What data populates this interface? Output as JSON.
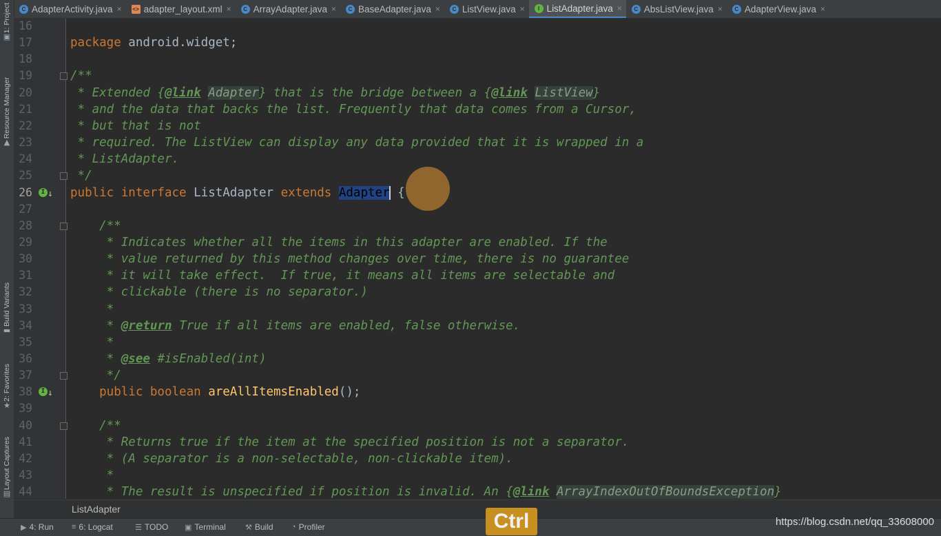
{
  "tabs": [
    {
      "label": "AdapterActivity.java",
      "icon": "C",
      "kind": "class",
      "active": false
    },
    {
      "label": "adapter_layout.xml",
      "icon": "<>",
      "kind": "xml",
      "active": false
    },
    {
      "label": "ArrayAdapter.java",
      "icon": "C",
      "kind": "class",
      "active": false
    },
    {
      "label": "BaseAdapter.java",
      "icon": "C",
      "kind": "class",
      "active": false
    },
    {
      "label": "ListView.java",
      "icon": "C",
      "kind": "class",
      "active": false
    },
    {
      "label": "ListAdapter.java",
      "icon": "I",
      "kind": "interface",
      "active": true
    },
    {
      "label": "AbsListView.java",
      "icon": "C",
      "kind": "class",
      "active": false
    },
    {
      "label": "AdapterView.java",
      "icon": "C",
      "kind": "class",
      "active": false
    }
  ],
  "tab_close_glyph": "×",
  "left_tools": [
    {
      "label": "1: Project",
      "icon": "project-icon"
    },
    {
      "label": "Resource Manager",
      "icon": "resource-manager-icon"
    },
    {
      "label": "Build Variants",
      "icon": "build-variants-icon"
    },
    {
      "label": "2: Favorites",
      "icon": "favorites-icon"
    },
    {
      "label": "Layout Captures",
      "icon": "layout-captures-icon"
    }
  ],
  "editor": {
    "current_line": 26,
    "lines": [
      {
        "n": 16,
        "tokens": []
      },
      {
        "n": 17,
        "tokens": [
          [
            "kw",
            "package "
          ],
          [
            "pl",
            "android.widget;"
          ]
        ]
      },
      {
        "n": 18,
        "tokens": []
      },
      {
        "n": 19,
        "fold": true,
        "tokens": [
          [
            "cm",
            "/**"
          ]
        ]
      },
      {
        "n": 20,
        "tokens": [
          [
            "cm",
            " * Extended {"
          ],
          [
            "tag",
            "@link"
          ],
          [
            "cm",
            " "
          ],
          [
            "ref",
            "Adapter"
          ],
          [
            "cm",
            "} that is the bridge between a {"
          ],
          [
            "tag",
            "@link"
          ],
          [
            "cm",
            " "
          ],
          [
            "ref",
            "ListView"
          ],
          [
            "cm",
            "}"
          ]
        ]
      },
      {
        "n": 21,
        "tokens": [
          [
            "cm",
            " * and the data that backs the list. Frequently that data comes from a Cursor,"
          ]
        ]
      },
      {
        "n": 22,
        "tokens": [
          [
            "cm",
            " * but that is not"
          ]
        ]
      },
      {
        "n": 23,
        "tokens": [
          [
            "cm",
            " * required. The ListView can display any data provided that it is wrapped in a"
          ]
        ]
      },
      {
        "n": 24,
        "tokens": [
          [
            "cm",
            " * ListAdapter."
          ]
        ]
      },
      {
        "n": 25,
        "fold": true,
        "tokens": [
          [
            "cm",
            " */"
          ]
        ]
      },
      {
        "n": 26,
        "gutter": "implemented",
        "tokens": [
          [
            "kw",
            "public interface "
          ],
          [
            "pl",
            "ListAdapter "
          ],
          [
            "kw",
            "extends "
          ],
          [
            "sel",
            "Adapter"
          ],
          [
            "caret",
            ""
          ],
          [
            "pl",
            " {"
          ]
        ]
      },
      {
        "n": 27,
        "tokens": []
      },
      {
        "n": 28,
        "fold": true,
        "tokens": [
          [
            "cm",
            "    /**"
          ]
        ]
      },
      {
        "n": 29,
        "tokens": [
          [
            "cm",
            "     * Indicates whether all the items in this adapter are enabled. If the"
          ]
        ]
      },
      {
        "n": 30,
        "tokens": [
          [
            "cm",
            "     * value returned by this method changes over time, there is no guarantee"
          ]
        ]
      },
      {
        "n": 31,
        "tokens": [
          [
            "cm",
            "     * it will take effect.  If true, it means all items are selectable and"
          ]
        ]
      },
      {
        "n": 32,
        "tokens": [
          [
            "cm",
            "     * clickable (there is no separator.)"
          ]
        ]
      },
      {
        "n": 33,
        "tokens": [
          [
            "cm",
            "     *"
          ]
        ]
      },
      {
        "n": 34,
        "tokens": [
          [
            "cm",
            "     * "
          ],
          [
            "tag",
            "@return"
          ],
          [
            "cm",
            " True if all items are enabled, false otherwise."
          ]
        ]
      },
      {
        "n": 35,
        "tokens": [
          [
            "cm",
            "     *"
          ]
        ]
      },
      {
        "n": 36,
        "tokens": [
          [
            "cm",
            "     * "
          ],
          [
            "tag",
            "@see"
          ],
          [
            "cm",
            " #isEnabled(int)"
          ]
        ]
      },
      {
        "n": 37,
        "fold": true,
        "tokens": [
          [
            "cm",
            "     */"
          ]
        ]
      },
      {
        "n": 38,
        "gutter": "implemented",
        "tokens": [
          [
            "kw",
            "    public boolean "
          ],
          [
            "fn",
            "areAllItemsEnabled"
          ],
          [
            "pl",
            "();"
          ]
        ]
      },
      {
        "n": 39,
        "tokens": []
      },
      {
        "n": 40,
        "fold": true,
        "tokens": [
          [
            "cm",
            "    /**"
          ]
        ]
      },
      {
        "n": 41,
        "tokens": [
          [
            "cm",
            "     * Returns true if the item at the specified position is not a separator."
          ]
        ]
      },
      {
        "n": 42,
        "tokens": [
          [
            "cm",
            "     * (A separator is a non-selectable, non-clickable item)."
          ]
        ]
      },
      {
        "n": 43,
        "tokens": [
          [
            "cm",
            "     *"
          ]
        ]
      },
      {
        "n": 44,
        "tokens": [
          [
            "cm",
            "     * The result is unspecified if position is invalid. An {"
          ],
          [
            "tag",
            "@link"
          ],
          [
            "cm",
            " "
          ],
          [
            "ref",
            "ArrayIndexOutOfBoundsException"
          ],
          [
            "cm",
            "}"
          ]
        ]
      }
    ]
  },
  "breadcrumb": "ListAdapter",
  "bottom_tools": [
    {
      "label": "4: Run",
      "icon": "run-icon",
      "glyph": "▶"
    },
    {
      "label": "6: Logcat",
      "icon": "logcat-icon",
      "glyph": "≡"
    },
    {
      "label": "TODO",
      "icon": "todo-icon",
      "glyph": "☰"
    },
    {
      "label": "Terminal",
      "icon": "terminal-icon",
      "glyph": "▣"
    },
    {
      "label": "Build",
      "icon": "build-icon",
      "glyph": "⚒"
    },
    {
      "label": "Profiler",
      "icon": "profiler-icon",
      "glyph": "◔"
    }
  ],
  "key_overlay": "Ctrl",
  "watermark": "https://blog.csdn.net/qq_33608000",
  "colors": {
    "keyword": "#cc7832",
    "plain": "#a9b7c6",
    "comment": "#629755",
    "method": "#ffc66d",
    "selection": "#214283",
    "background": "#2b2b2b"
  }
}
